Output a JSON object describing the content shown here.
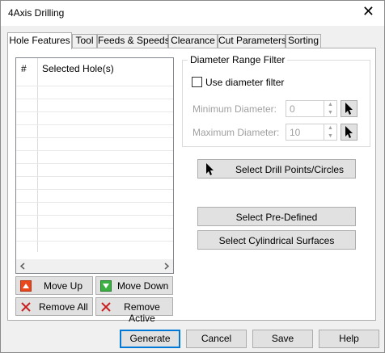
{
  "window": {
    "title": "4Axis Drilling",
    "close_glyph": "✕"
  },
  "tabs": [
    {
      "label": "Hole Features",
      "active": true
    },
    {
      "label": "Tool"
    },
    {
      "label": "Feeds & Speeds"
    },
    {
      "label": "Clearance"
    },
    {
      "label": "Cut Parameters"
    },
    {
      "label": "Sorting"
    }
  ],
  "hole_list": {
    "columns": [
      "#",
      "Selected Hole(s)"
    ]
  },
  "list_buttons": {
    "move_up": "Move Up",
    "move_down": "Move Down",
    "remove_all": "Remove All",
    "remove_active": "Remove Active"
  },
  "diameter_filter": {
    "group_label": "Diameter Range Filter",
    "checkbox_label": "Use diameter filter",
    "min_label": "Minimum Diameter:",
    "min_value": "0",
    "max_label": "Maximum Diameter:",
    "max_value": "10"
  },
  "select_buttons": {
    "drill_points": "Select Drill Points/Circles",
    "predefined": "Select Pre-Defined",
    "cylindrical": "Select Cylindrical Surfaces"
  },
  "footer": {
    "generate": "Generate",
    "cancel": "Cancel",
    "save": "Save",
    "help": "Help"
  },
  "colors": {
    "move_up_icon": "#e8481c",
    "move_down_icon": "#3cb043",
    "remove_icon": "#c81e1e",
    "default_button_border": "#0078d7"
  }
}
